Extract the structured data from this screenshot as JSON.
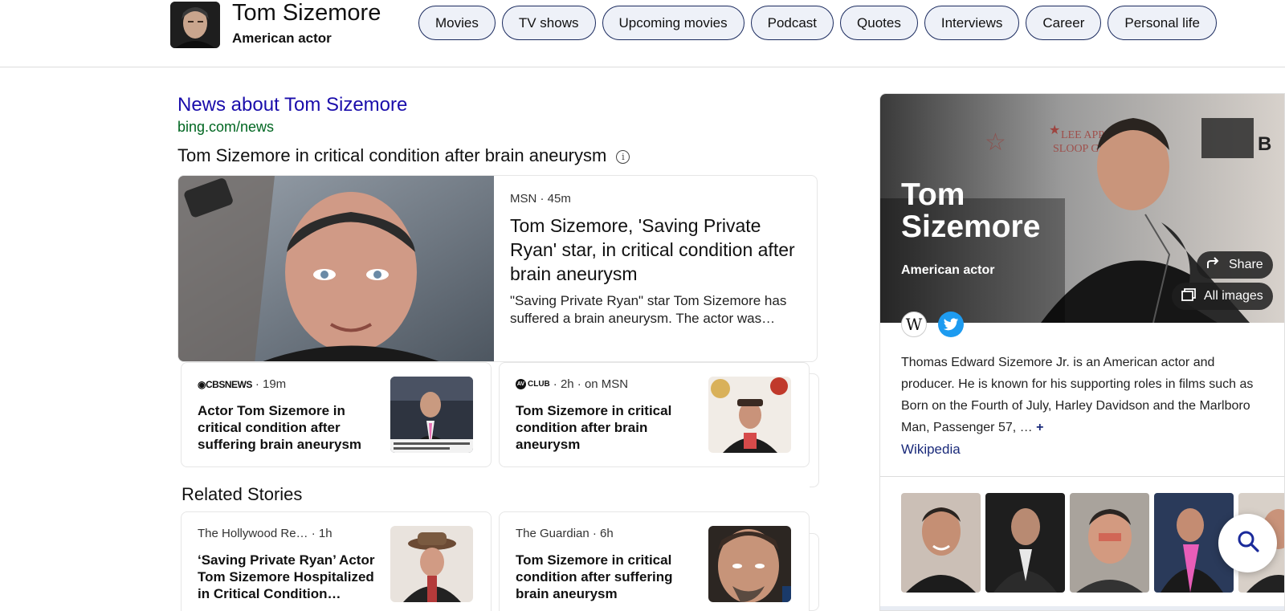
{
  "header": {
    "title": "Tom Sizemore",
    "subtitle": "American actor",
    "pills": [
      "Movies",
      "TV shows",
      "Upcoming movies",
      "Podcast",
      "Quotes",
      "Interviews",
      "Career",
      "Personal life"
    ]
  },
  "news": {
    "heading": "News about Tom Sizemore",
    "url": "bing.com/news",
    "topic": "Tom Sizemore in critical condition after brain aneurysm",
    "info_icon": "i",
    "main": {
      "source": "MSN · 45m",
      "title": "Tom Sizemore, 'Saving Private Ryan' star, in critical condition after brain aneurysm",
      "snippet": "\"Saving Private Ryan\" star Tom Sizemore has suffered a brain aneurysm. The actor was hospitalized..."
    },
    "cards": [
      {
        "logo": "CBSNEWS",
        "time": "· 19m",
        "title": "Actor Tom Sizemore in critical condition after suffering brain aneurysm"
      },
      {
        "logo": "CLUB",
        "logo_badge": "AV",
        "time": "· 2h · on MSN",
        "title": "Tom Sizemore in critical condition after brain aneurysm"
      }
    ]
  },
  "related": {
    "heading": "Related Stories",
    "cards": [
      {
        "source": "The Hollywood Re… · 1h",
        "title": "‘Saving Private Ryan’ Actor Tom Sizemore Hospitalized in Critical Condition…"
      },
      {
        "source": "The Guardian · 6h",
        "title": "Tom Sizemore in critical condition after suffering brain aneurysm"
      }
    ]
  },
  "panel": {
    "name_line1": "Tom",
    "name_line2": "Sizemore",
    "subtitle": "American actor",
    "share_label": "Share",
    "all_images_label": "All images",
    "wiki_glyph": "W",
    "description": "Thomas Edward Sizemore Jr. is an American actor and producer. He is known for his supporting roles in films such as Born on the Fourth of July, Harley Davidson and the Marlboro Man, Passenger 57, …",
    "more_glyph": "+",
    "source_link": "Wikipedia"
  },
  "colors": {
    "link_blue": "#1a0dab",
    "url_green": "#006621",
    "pill_border": "#1a2a5e",
    "twitter": "#1d9bf0"
  },
  "icons": [
    "info-icon",
    "share-icon",
    "images-icon",
    "wikipedia-icon",
    "twitter-icon",
    "search-icon"
  ]
}
